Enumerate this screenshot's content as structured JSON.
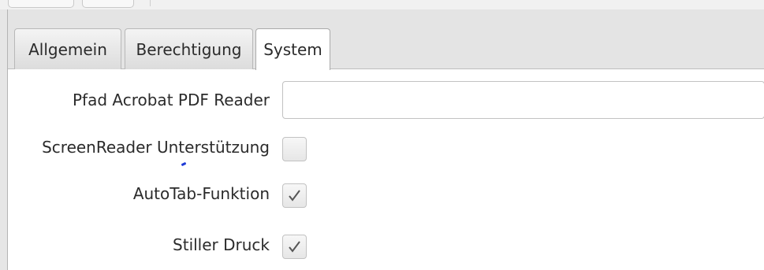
{
  "tabs": [
    {
      "label": "Allgemein",
      "selected": false
    },
    {
      "label": "Berechtigung",
      "selected": false
    },
    {
      "label": "System",
      "selected": true
    }
  ],
  "form": {
    "acrobat_path": {
      "label": "Pfad Acrobat PDF Reader",
      "value": ""
    },
    "screenreader": {
      "label": "ScreenReader Unterstützung",
      "checked": false
    },
    "autotab": {
      "label": "AutoTab-Funktion",
      "checked": true
    },
    "silent_print": {
      "label": "Stiller Druck",
      "checked": true
    }
  },
  "icons": {
    "checked_mark": "check-icon"
  },
  "colors": {
    "tab_bar_bg": "#e4e4e4",
    "selected_tab_bg": "#ffffff",
    "border": "#c2c2c2"
  }
}
